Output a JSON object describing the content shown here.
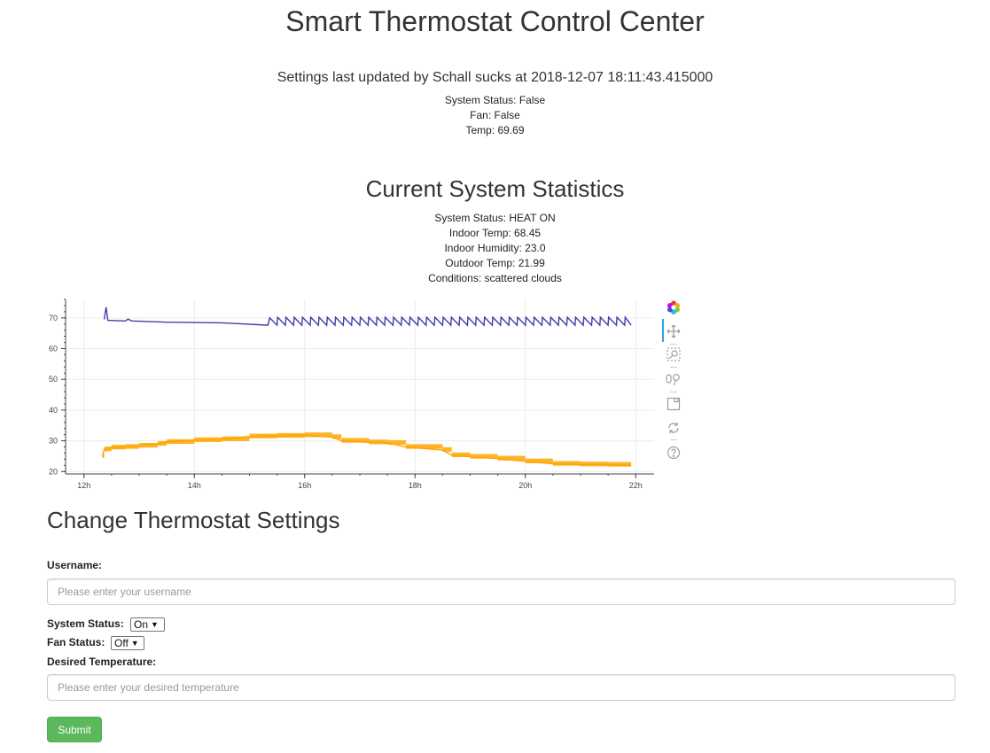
{
  "page": {
    "title": "Smart Thermostat Control Center",
    "updated_line": "Settings last updated by Schall sucks at 2018-12-07 18:11:43.415000",
    "settings": [
      "System Status: False",
      "Fan: False",
      "Temp: 69.69"
    ]
  },
  "stats": {
    "title": "Current System Statistics",
    "lines": [
      "System Status: HEAT ON",
      "Indoor Temp: 68.45",
      "Indoor Humidity: 23.0",
      "Outdoor Temp: 21.99",
      "Conditions: scattered clouds"
    ]
  },
  "chart_data": {
    "type": "line",
    "xlabel": "",
    "ylabel": "",
    "x_ticks": [
      "12h",
      "14h",
      "16h",
      "18h",
      "20h",
      "22h"
    ],
    "y_ticks": [
      "20",
      "30",
      "40",
      "50",
      "60",
      "70"
    ],
    "xlim": [
      "11:40",
      "22:20"
    ],
    "ylim": [
      19.5,
      76
    ],
    "grid": true,
    "series": [
      {
        "color": "#3f3fa8",
        "points": [
          [
            "12:22",
            69.5
          ],
          [
            "12:24",
            73.5
          ],
          [
            "12:26",
            69.2
          ],
          [
            "12:45",
            69.0
          ],
          [
            "12:48",
            69.6
          ],
          [
            "12:52",
            69.0
          ],
          [
            "13:30",
            68.6
          ],
          [
            "14:30",
            68.4
          ],
          [
            "15:20",
            67.6
          ],
          [
            "15:22",
            70.0
          ],
          [
            "15:30",
            67.6
          ]
        ],
        "sawtooth": {
          "start": "15:30",
          "end": "21:55",
          "period_min": 9,
          "low": 67.6,
          "high": 70.2
        }
      },
      {
        "color": "#ffa500",
        "points": [
          [
            "12:20",
            25.0
          ],
          [
            "12:22",
            27.2
          ],
          [
            "12:30",
            27.8
          ],
          [
            "12:45",
            28.0
          ],
          [
            "13:00",
            28.4
          ],
          [
            "13:20",
            29.0
          ],
          [
            "13:30",
            29.6
          ],
          [
            "14:00",
            30.2
          ],
          [
            "14:30",
            30.5
          ],
          [
            "15:00",
            31.4
          ],
          [
            "15:30",
            31.6
          ],
          [
            "16:00",
            31.8
          ],
          [
            "16:30",
            31.2
          ],
          [
            "16:40",
            30.0
          ],
          [
            "17:10",
            29.5
          ],
          [
            "17:30",
            29.3
          ],
          [
            "17:50",
            28.0
          ],
          [
            "18:30",
            27.0
          ],
          [
            "18:40",
            25.3
          ],
          [
            "19:00",
            24.8
          ],
          [
            "19:30",
            24.2
          ],
          [
            "20:00",
            23.3
          ],
          [
            "20:30",
            22.5
          ],
          [
            "21:00",
            22.3
          ],
          [
            "21:30",
            22.2
          ],
          [
            "21:55",
            22.0
          ]
        ]
      }
    ]
  },
  "toolbar": {
    "icons": [
      "bokeh-logo-icon",
      "pan-icon",
      "box-zoom-icon",
      "wheel-zoom-icon",
      "save-icon",
      "reset-icon",
      "help-icon"
    ]
  },
  "form": {
    "title": "Change Thermostat Settings",
    "username_label": "Username:",
    "username_placeholder": "Please enter your username",
    "system_status_label": "System Status:",
    "system_status_value": "On",
    "fan_status_label": "Fan Status:",
    "fan_status_value": "Off",
    "desired_temp_label": "Desired Temperature:",
    "desired_temp_placeholder": "Please enter your desired temperature",
    "submit_label": "Submit"
  },
  "colors": {
    "submit": "#5cb85c",
    "indoor_line": "#3f3fa8",
    "outdoor_line": "#ffa500"
  }
}
